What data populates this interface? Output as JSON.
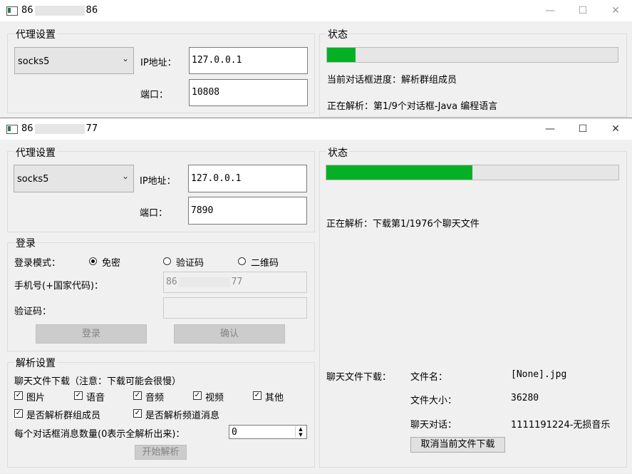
{
  "window_back": {
    "title_prefix": "86",
    "title_suffix": "86",
    "proxy_group_label": "代理设置",
    "proxy_type": "socks5",
    "ip_label": "IP地址：",
    "ip_value": "127.0.0.1",
    "port_label": "端口：",
    "port_value": "10808",
    "status_group_label": "状态",
    "progress_fraction": 0.097,
    "dialog_progress": "当前对话框进度：解析群组成员",
    "parsing_text": "正在解析：第1/9个对话框-Java 编程语言"
  },
  "window_front": {
    "title_prefix": "86",
    "title_suffix": "77",
    "proxy_group_label": "代理设置",
    "proxy_type": "socks5",
    "ip_label": "IP地址：",
    "ip_value": "127.0.0.1",
    "port_label": "端口：",
    "port_value": "7890",
    "login_group_label": "登录",
    "login_mode_label": "登录模式：",
    "mode_free": "免密",
    "mode_code": "验证码",
    "mode_qr": "二维码",
    "phone_label": "手机号(+国家代码)：",
    "phone_prefix": "86",
    "phone_suffix": "77",
    "code_label": "验证码：",
    "login_button": "登录",
    "confirm_button": "确认",
    "parse_group_label": "解析设置",
    "download_note": "聊天文件下载（注意：下载可能会很慢）",
    "cb_image": "图片",
    "cb_voice": "语音",
    "cb_audio": "音频",
    "cb_video": "视频",
    "cb_other": "其他",
    "cb_group_members": "是否解析群组成员",
    "cb_channel_msgs": "是否解析频道消息",
    "msg_count_label": "每个对话框消息数量(0表示全解析出来)：",
    "msg_count_value": "0",
    "start_button": "开始解析",
    "status_group_label": "状态",
    "progress_fraction": 0.5,
    "parsing_text": "正在解析：下载第1/1976个聊天文件",
    "download_label": "聊天文件下载：",
    "file_name_label": "文件名：",
    "file_name_value": "[None].jpg",
    "file_size_label": "文件大小：",
    "file_size_value": "36280",
    "chat_label": "聊天对话：",
    "chat_value": "1111191224-无损音乐",
    "cancel_button": "取消当前文件下载"
  },
  "controls": {
    "minimize": "—",
    "maximize": "☐",
    "close": "✕"
  },
  "colors": {
    "progress": "#06b025",
    "window_bg": "#f0f0f0"
  }
}
